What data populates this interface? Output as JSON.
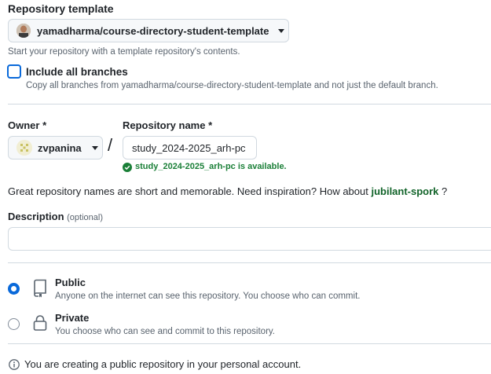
{
  "template": {
    "label": "Repository template",
    "selected": "yamadharma/course-directory-student-template",
    "help": "Start your repository with a template repository's contents."
  },
  "include_branches": {
    "label": "Include all branches",
    "help": "Copy all branches from yamadharma/course-directory-student-template and not just the default branch."
  },
  "owner": {
    "label": "Owner *",
    "value": "zvpanina"
  },
  "separator": "/",
  "repo_name": {
    "label": "Repository name *",
    "value": "study_2024-2025_arh-pc",
    "status": "study_2024-2025_arh-pc is available."
  },
  "suggestion": {
    "text": "Great repository names are short and memorable. Need inspiration? How about ",
    "name": "jubilant-spork",
    "tail": " ?"
  },
  "description": {
    "label": "Description",
    "optional": "(optional)",
    "value": ""
  },
  "visibility": {
    "public": {
      "label": "Public",
      "help": "Anyone on the internet can see this repository. You choose who can commit."
    },
    "private": {
      "label": "Private",
      "help": "You choose who can see and commit to this repository."
    }
  },
  "notice": "You are creating a public repository in your personal account.",
  "colors": {
    "accent": "#0969da",
    "success": "#1a7f37",
    "link_green": "#116329"
  }
}
